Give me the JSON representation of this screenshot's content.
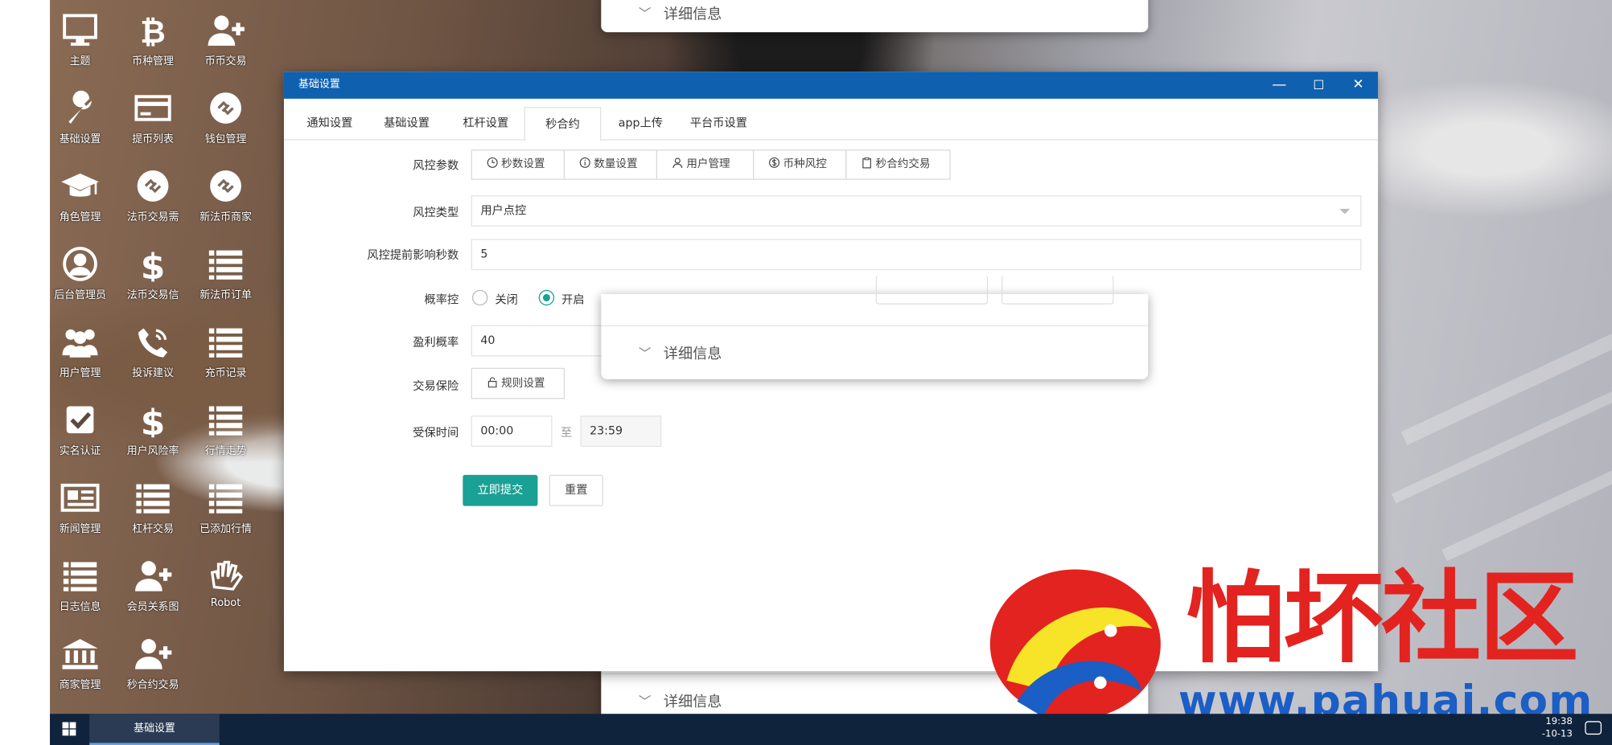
{
  "desktop_icons": [
    {
      "label": "主题",
      "icon": "monitor-icon"
    },
    {
      "label": "币种管理",
      "icon": "bitcoin-icon"
    },
    {
      "label": "币币交易",
      "icon": "user-add-icon"
    },
    {
      "label": "基础设置",
      "icon": "wrench-icon"
    },
    {
      "label": "提币列表",
      "icon": "credit-card-icon"
    },
    {
      "label": "钱包管理",
      "icon": "link-circle-icon"
    },
    {
      "label": "角色管理",
      "icon": "graduation-cap-icon"
    },
    {
      "label": "法币交易需",
      "icon": "link-circle-icon"
    },
    {
      "label": "新法币商家",
      "icon": "link-circle-icon"
    },
    {
      "label": "后台管理员",
      "icon": "user-circle-icon"
    },
    {
      "label": "法币交易信",
      "icon": "dollar-icon"
    },
    {
      "label": "新法币订单",
      "icon": "list-icon"
    },
    {
      "label": "用户管理",
      "icon": "users-icon"
    },
    {
      "label": "投诉建议",
      "icon": "phone-icon"
    },
    {
      "label": "充币记录",
      "icon": "list-icon"
    },
    {
      "label": "实名认证",
      "icon": "check-box-icon"
    },
    {
      "label": "用户风险率",
      "icon": "dollar-icon"
    },
    {
      "label": "行情走势",
      "icon": "list-icon"
    },
    {
      "label": "新闻管理",
      "icon": "newspaper-icon"
    },
    {
      "label": "杠杆交易",
      "icon": "list-icon"
    },
    {
      "label": "已添加行情",
      "icon": "list-icon"
    },
    {
      "label": "日志信息",
      "icon": "list-icon"
    },
    {
      "label": "会员关系图",
      "icon": "user-add-icon"
    },
    {
      "label": "Robot",
      "icon": "hand-icon"
    },
    {
      "label": "商家管理",
      "icon": "bank-icon"
    },
    {
      "label": "秒合约交易",
      "icon": "user-add-icon"
    }
  ],
  "bg_card": {
    "detail_label": "详细信息"
  },
  "window": {
    "title": "基础设置",
    "controls": {
      "minimize": "—",
      "maximize": "☐",
      "close": "✕"
    },
    "tabs": [
      {
        "label": "通知设置"
      },
      {
        "label": "基础设置"
      },
      {
        "label": "杠杆设置"
      },
      {
        "label": "秒合约",
        "active": true
      },
      {
        "label": "app上传"
      },
      {
        "label": "平台币设置"
      }
    ],
    "form": {
      "risk_params_label": "风控参数",
      "risk_params_buttons": [
        {
          "label": "秒数设置",
          "icon": "clock-icon"
        },
        {
          "label": "数量设置",
          "icon": "info-icon"
        },
        {
          "label": "用户管理",
          "icon": "user-icon"
        },
        {
          "label": "币种风控",
          "icon": "dollar-circle-icon"
        },
        {
          "label": "秒合约交易",
          "icon": "clipboard-icon"
        }
      ],
      "risk_type_label": "风控类型",
      "risk_type_value": "用户点控",
      "advance_seconds_label": "风控提前影响秒数",
      "advance_seconds_value": "5",
      "probability_label": "概率控",
      "probability_off": "关闭",
      "probability_on": "开启",
      "probability_selected": "开启",
      "win_rate_label": "盈利概率",
      "win_rate_value": "40",
      "trade_protect_label": "交易保险",
      "rule_button": "规则设置",
      "protect_time_label": "受保时间",
      "time_start": "00:00",
      "time_sep": "至",
      "time_end": "23:59",
      "submit": "立即提交",
      "reset": "重置"
    }
  },
  "taskbar": {
    "app": "基础设置",
    "time": "19:38",
    "date": "-10-13"
  },
  "watermark": {
    "text": "怕坏社区",
    "url": "www.pahuai.com"
  },
  "colors": {
    "titlebar": "#0f61b0",
    "primary": "#1aa094",
    "taskbar": "#10233c",
    "watermark_red": "#e3231f",
    "watermark_blue": "#1b5ec5"
  }
}
